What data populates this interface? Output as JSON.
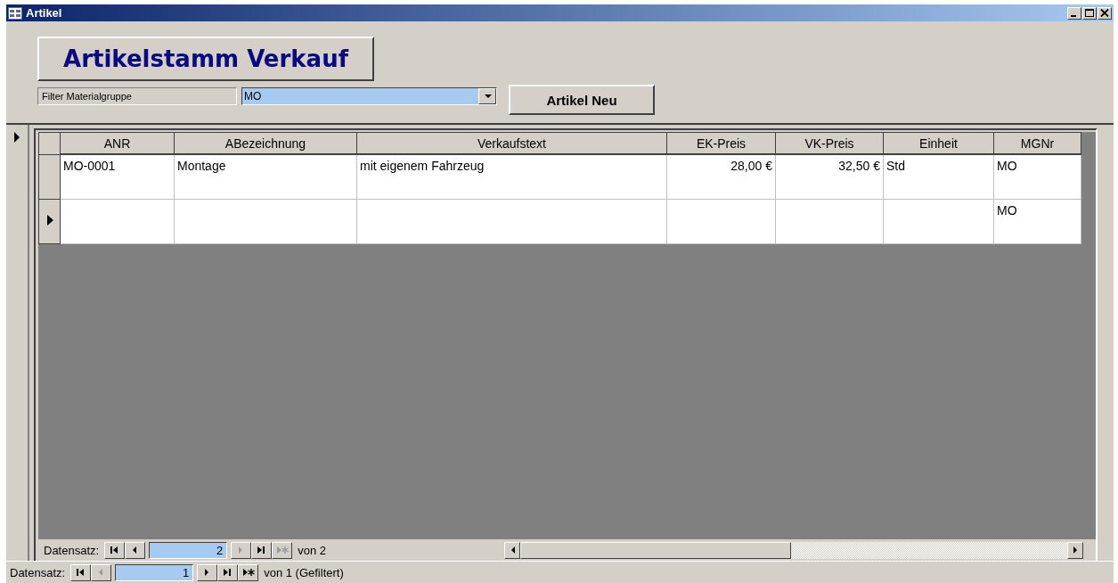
{
  "window": {
    "title": "Artikel"
  },
  "header": {
    "title": "Artikelstamm Verkauf",
    "filter_label": "Filter Materialgruppe",
    "filter_value": "MO",
    "new_button": "Artikel Neu"
  },
  "form_record_selector": {
    "current": true
  },
  "datasheet": {
    "columns": [
      {
        "label": "ANR"
      },
      {
        "label": "ABezeichnung"
      },
      {
        "label": "Verkaufstext"
      },
      {
        "label": "EK-Preis"
      },
      {
        "label": "VK-Preis"
      },
      {
        "label": "Einheit"
      },
      {
        "label": "MGNr"
      }
    ],
    "rows": [
      {
        "current": false,
        "cells": [
          "MO-0001",
          "Montage",
          "mit eigenem Fahrzeug",
          "28,00 €",
          "32,50 €",
          "Std",
          "MO"
        ]
      },
      {
        "current": true,
        "cells": [
          "",
          "",
          "",
          "",
          "",
          "",
          "MO"
        ]
      }
    ]
  },
  "subform_navigation": {
    "label": "Datensatz:",
    "record": "2",
    "total": "von 2",
    "buttons": [
      {
        "kind": "first",
        "disabled": false
      },
      {
        "kind": "prev",
        "disabled": false
      },
      {
        "kind": "next",
        "disabled": true
      },
      {
        "kind": "last",
        "disabled": false
      },
      {
        "kind": "new",
        "disabled": true
      }
    ]
  },
  "form_navigation": {
    "label": "Datensatz:",
    "record": "1",
    "total": "von 1 (Gefiltert)",
    "buttons": [
      {
        "kind": "first",
        "disabled": false
      },
      {
        "kind": "prev",
        "disabled": true
      },
      {
        "kind": "next",
        "disabled": false
      },
      {
        "kind": "last",
        "disabled": false
      },
      {
        "kind": "new",
        "disabled": false
      }
    ]
  }
}
